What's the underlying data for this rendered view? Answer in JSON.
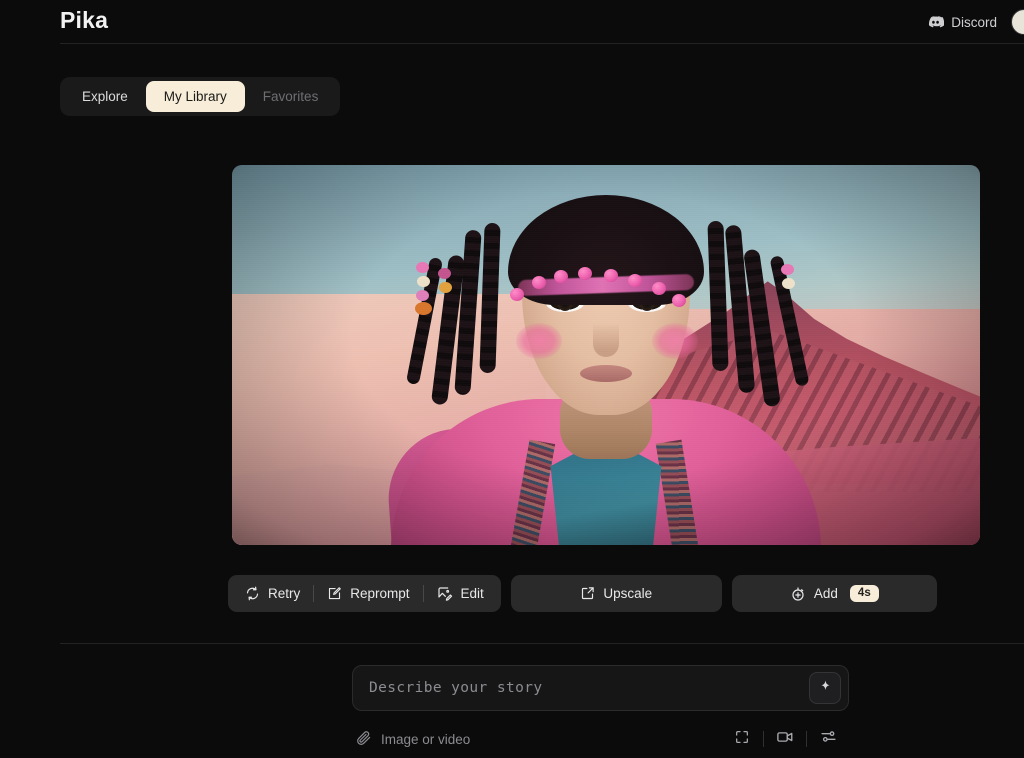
{
  "app": {
    "brand": "Pika",
    "theme_bg": "#0b0b0c",
    "accent_cream": "#f7edd9"
  },
  "header": {
    "brand_label": "Pika",
    "discord_label": "Discord",
    "discord_icon": "discord-icon",
    "avatar_icon": "user-avatar"
  },
  "tabs": [
    {
      "label": "Explore",
      "active": false,
      "dimmed": false
    },
    {
      "label": "My Library",
      "active": true,
      "dimmed": false
    },
    {
      "label": "Favorites",
      "active": false,
      "dimmed": true
    }
  ],
  "video": {
    "alt": "AI generated video frame: woman with beaded black dreadlocks, pink blush circles on cheeks, pink coat and teal inner robe, standing in a pink desert with crimson mountains under a teal sky",
    "sky_color": "#9fc0c6",
    "mountain_color": "#b4505f",
    "sand_color": "#eec2b4",
    "coat_color": "#e2609a",
    "robe_color": "#34798e",
    "blush_color": "#ec689e"
  },
  "actions": {
    "retry": {
      "label": "Retry",
      "icon": "retry-icon"
    },
    "reprompt": {
      "label": "Reprompt",
      "icon": "reprompt-icon"
    },
    "edit": {
      "label": "Edit",
      "icon": "edit-image-icon"
    },
    "upscale": {
      "label": "Upscale",
      "icon": "upscale-icon"
    },
    "add": {
      "label": "Add",
      "icon": "stopwatch-plus-icon",
      "badge": "4s"
    }
  },
  "composer": {
    "placeholder": "Describe your story",
    "value": "",
    "generate_icon": "sparkle-icon",
    "attach_label": "Image or video",
    "attach_icon": "paperclip-icon",
    "tools": [
      {
        "name": "aspect-ratio-icon"
      },
      {
        "name": "video-camera-icon"
      },
      {
        "name": "settings-sliders-icon"
      }
    ]
  }
}
